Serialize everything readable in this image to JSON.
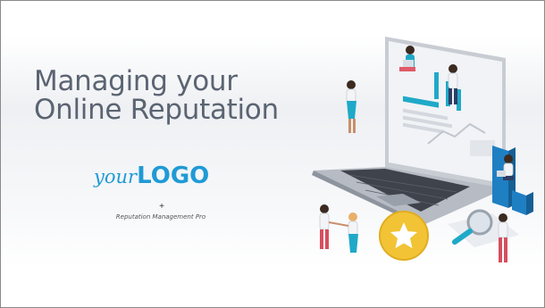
{
  "slide": {
    "title_line1": "Managing your",
    "title_line2": "Online Reputation",
    "logo_script": "your",
    "logo_bold": "LOGO",
    "separator": "+",
    "tagline": "Reputation Management Pro"
  },
  "colors": {
    "title": "#5b6472",
    "logo": "#1f9ad6",
    "teal_accent": "#1fa9c8",
    "star_badge": "#f2c335",
    "laptop_body": "#a7adb8"
  },
  "icons": [
    "star-icon",
    "magnifier-icon"
  ]
}
